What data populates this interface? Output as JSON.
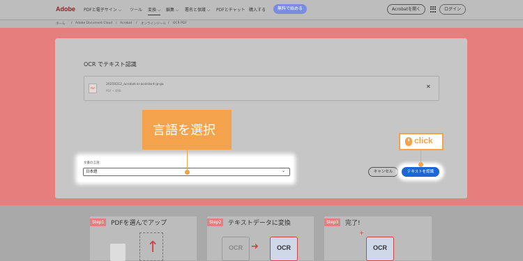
{
  "nav": {
    "logo": "Adobe",
    "items": [
      "PDFと電子サイン ⌵",
      "ツール",
      "変換 ⌵",
      "編集 ⌵",
      "署名と保護 ⌵",
      "PDFとチャット",
      "購入する"
    ],
    "trial_button": "無料で始める",
    "open_acrobat": "Acrobatを開く",
    "login": "ログイン"
  },
  "breadcrumb": [
    "ホーム",
    "/",
    "Adobe Document Cloud",
    "/",
    "Acrobat",
    "/",
    "オンラインツール",
    "/",
    "OCR PDF"
  ],
  "card": {
    "title": "OCR でテキスト認識",
    "file_name": "20250212_acrobat-ai-assistant-jp-ga",
    "file_meta": "PDF • 4MB",
    "file_type_icon": "PDF",
    "language_label": "文書の言語：",
    "language_value": "日本語",
    "cancel_button": "キャンセル",
    "recognize_button": "テキストを認識"
  },
  "annotations": {
    "select_language": "言語を選択",
    "click": "click"
  },
  "steps": [
    {
      "badge": "Step1",
      "title": "PDFを選んでアップ"
    },
    {
      "badge": "Step2",
      "title": "テキストデータに変換"
    },
    {
      "badge": "Step3",
      "title": "完了!"
    }
  ],
  "illustrations": {
    "ocr_before": "OCR",
    "ocr_after": "OCR",
    "ocr_done": "OCR"
  },
  "colors": {
    "accent_orange": "#f4a24b",
    "primary_blue": "#1a67d7",
    "band_pink": "#e77e7e",
    "trial_button": "#7a8ce0"
  }
}
